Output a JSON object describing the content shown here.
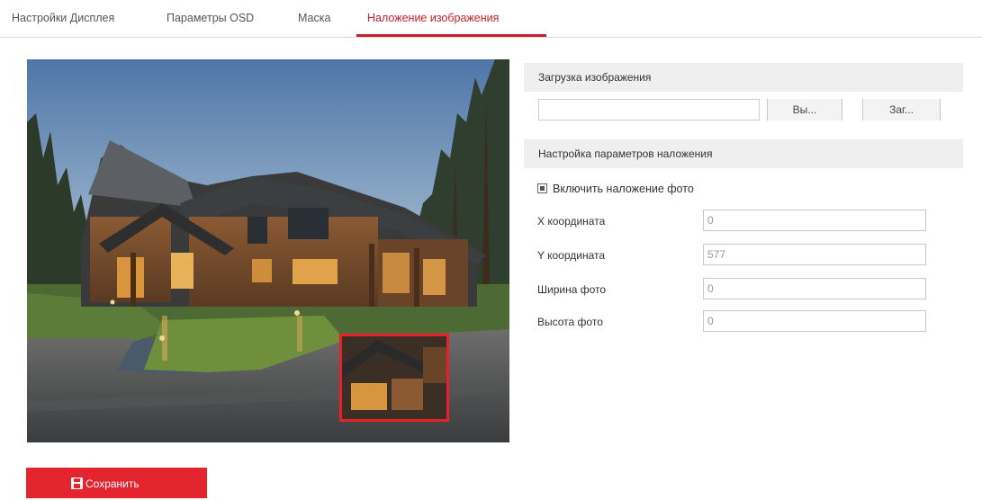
{
  "tabs": [
    {
      "label": "Настройки Дисплея",
      "active": false
    },
    {
      "label": "Параметры OSD",
      "active": false
    },
    {
      "label": "Маска",
      "active": false
    },
    {
      "label": "Наложение изображения",
      "active": true
    }
  ],
  "colors": {
    "accent": "#e4242e",
    "active_tab": "#c9202b",
    "section_bg": "#efefef"
  },
  "upload": {
    "header": "Загрузка изображения",
    "file_value": "",
    "browse_label": "Вы...",
    "upload_label": "Заг..."
  },
  "overlay_settings": {
    "header": "Настройка параметров наложения",
    "enable_label": "Включить наложение фото",
    "enable_checked": true,
    "fields": [
      {
        "label": "X координата",
        "value": "0"
      },
      {
        "label": "Y координата",
        "value": "577"
      },
      {
        "label": "Ширина фото",
        "value": "0"
      },
      {
        "label": "Высота фото",
        "value": "0"
      }
    ]
  },
  "save": {
    "label": "Сохранить",
    "icon": "floppy-disk-icon"
  }
}
